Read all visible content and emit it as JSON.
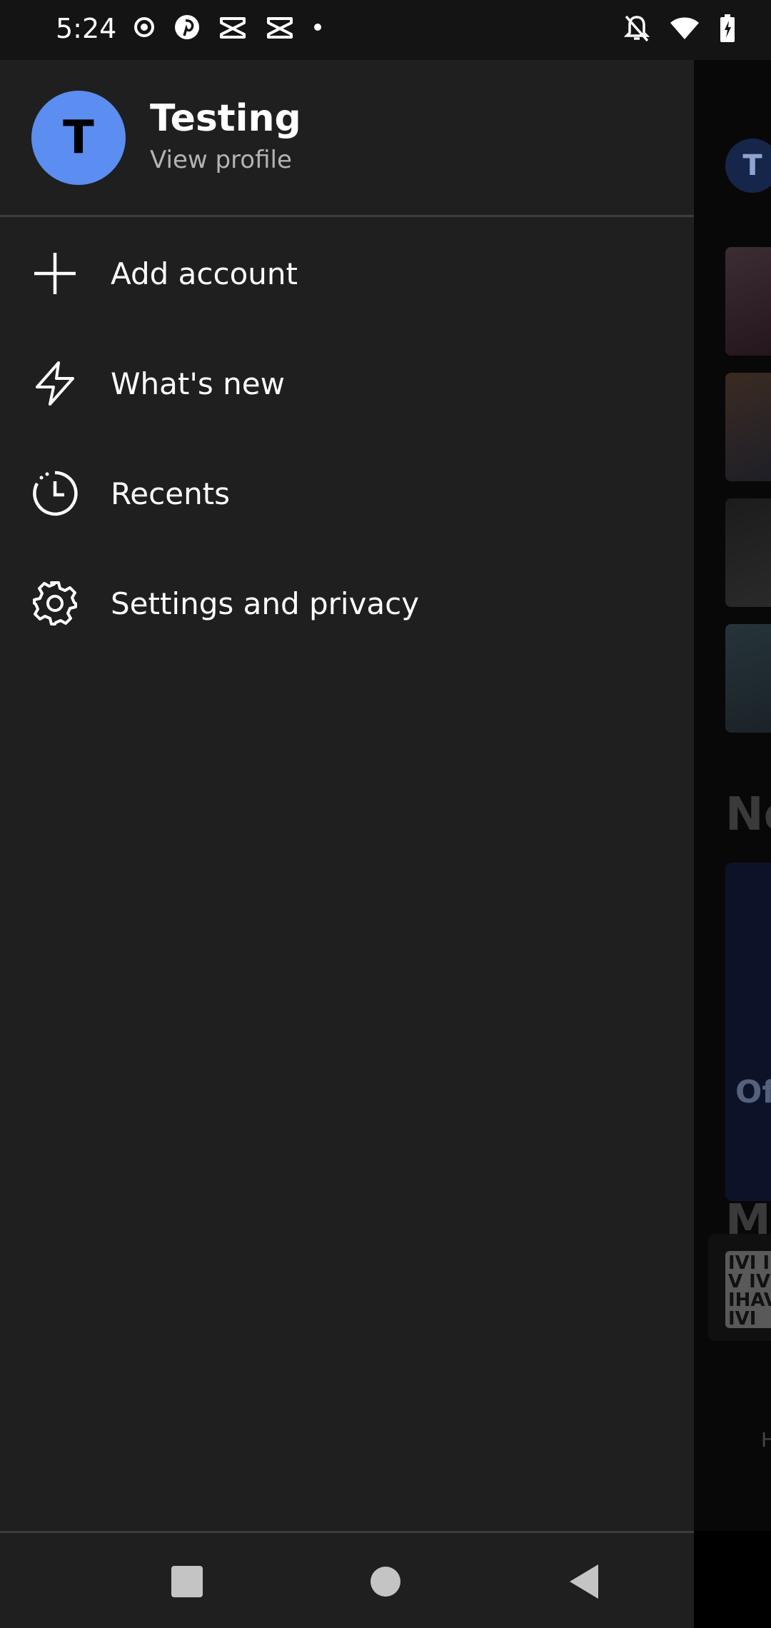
{
  "status_bar": {
    "time": "5:24",
    "left_icons": [
      "record-icon",
      "pinterest-icon",
      "capcut-icon",
      "capcut-icon",
      "dot-icon"
    ],
    "right_icons": [
      "bell-off-icon",
      "wifi-icon",
      "battery-charging-icon"
    ]
  },
  "drawer": {
    "avatar_letter": "T",
    "profile_name": "Testing",
    "profile_link": "View profile",
    "items": [
      {
        "label": "Add account",
        "icon": "plus-icon"
      },
      {
        "label": "What's new",
        "icon": "lightning-icon"
      },
      {
        "label": "Recents",
        "icon": "clock-icon"
      },
      {
        "label": "Settings and privacy",
        "icon": "gear-icon"
      }
    ]
  },
  "background_app": {
    "avatar_letter": "T",
    "heading_1": "No",
    "card_text": "Of",
    "heading_2": "Mu",
    "mini_art_text": "IVI I' V IVI IHAV IVI",
    "footer_text": "H"
  },
  "nav_bar": {
    "buttons": [
      "recents-button",
      "home-button",
      "back-button"
    ]
  },
  "colors": {
    "drawer_bg": "#1f1f1f",
    "avatar_bg": "#5b8ef0",
    "secondary_text": "#b3b3b3",
    "divider": "#3d3d3d"
  }
}
